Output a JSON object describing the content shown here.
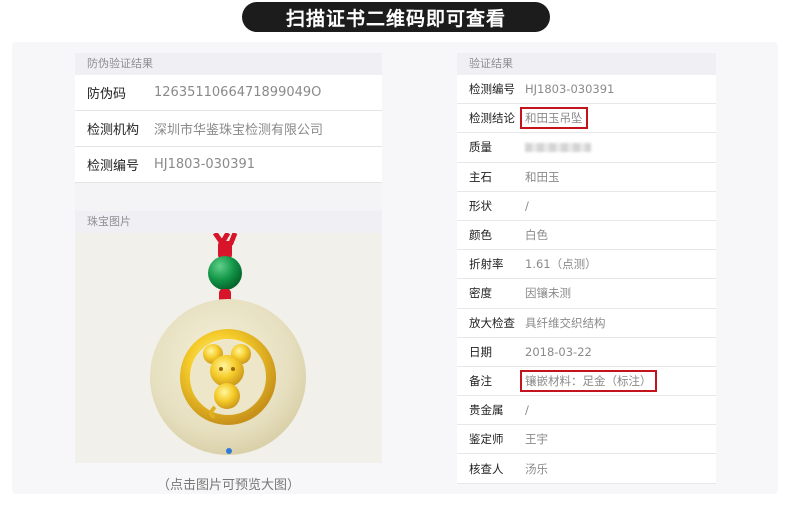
{
  "banner": {
    "title": "扫描证书二维码即可查看"
  },
  "left_panel": {
    "section_title": "防伪验证结果",
    "rows": [
      {
        "label": "防伪码",
        "value": "1263511066471899049O"
      },
      {
        "label": "检测机构",
        "value": "深圳市华鉴珠宝检测有限公司"
      },
      {
        "label": "检测编号",
        "value": "HJ1803-030391"
      }
    ],
    "image_section_title": "珠宝图片",
    "image_caption": "（点击图片可预览大图）"
  },
  "right_panel": {
    "section_title": "验证结果",
    "rows": [
      {
        "label": "检测编号",
        "value": "HJ1803-030391"
      },
      {
        "label": "检测结论",
        "value": "和田玉吊坠"
      },
      {
        "label": "质量",
        "value": ""
      },
      {
        "label": "主石",
        "value": "和田玉"
      },
      {
        "label": "形状",
        "value": "/"
      },
      {
        "label": "颜色",
        "value": "白色"
      },
      {
        "label": "折射率",
        "value": "1.61（点测）"
      },
      {
        "label": "密度",
        "value": "因镶未测"
      },
      {
        "label": "放大检查",
        "value": "具纤维交织结构"
      },
      {
        "label": "日期",
        "value": "2018-03-22"
      },
      {
        "label": "备注",
        "value": "镶嵌材料：足金（标注）"
      },
      {
        "label": "贵金属",
        "value": "/"
      },
      {
        "label": "鉴定师",
        "value": "王宇"
      },
      {
        "label": "核查人",
        "value": "汤乐"
      }
    ]
  },
  "colors": {
    "highlight_border": "#c3141e",
    "banner_bg": "#1c1c1c",
    "page_indicator": "#2f7bd9"
  }
}
